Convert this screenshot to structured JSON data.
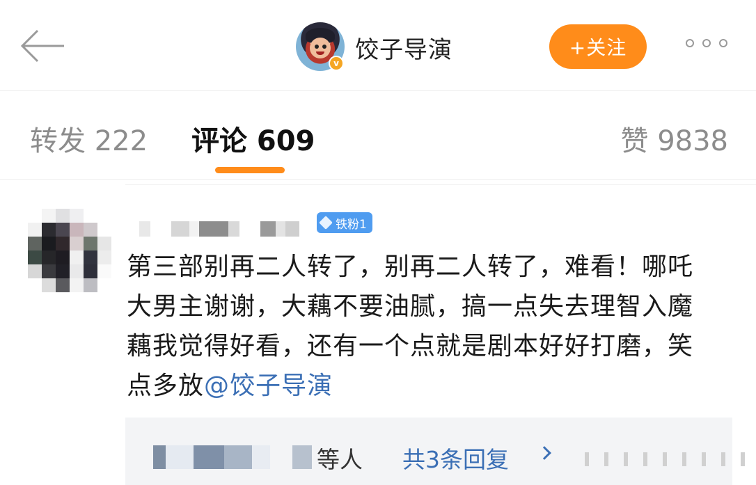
{
  "header": {
    "title": "饺子导演",
    "follow_label": "+关注"
  },
  "tabs": [
    {
      "label": "转发 222"
    },
    {
      "label": "评论 609"
    },
    {
      "label": "赞 9838"
    }
  ],
  "comment": {
    "badge": "铁粉1",
    "text": "第三部别再二人转了，别再二人转了，难看！哪吒大男主谢谢，大藕不要油腻，搞一点失去理智入魔藕我觉得好看，还有一个点就是剧本好好打磨，笑点多放",
    "mention": "@饺子导演",
    "replies_suffix": "等人",
    "replies_link": "共3条回复"
  },
  "colors": {
    "accent": "#ff8c1a",
    "link": "#3b6fb5",
    "badge": "#4f9cf0"
  }
}
